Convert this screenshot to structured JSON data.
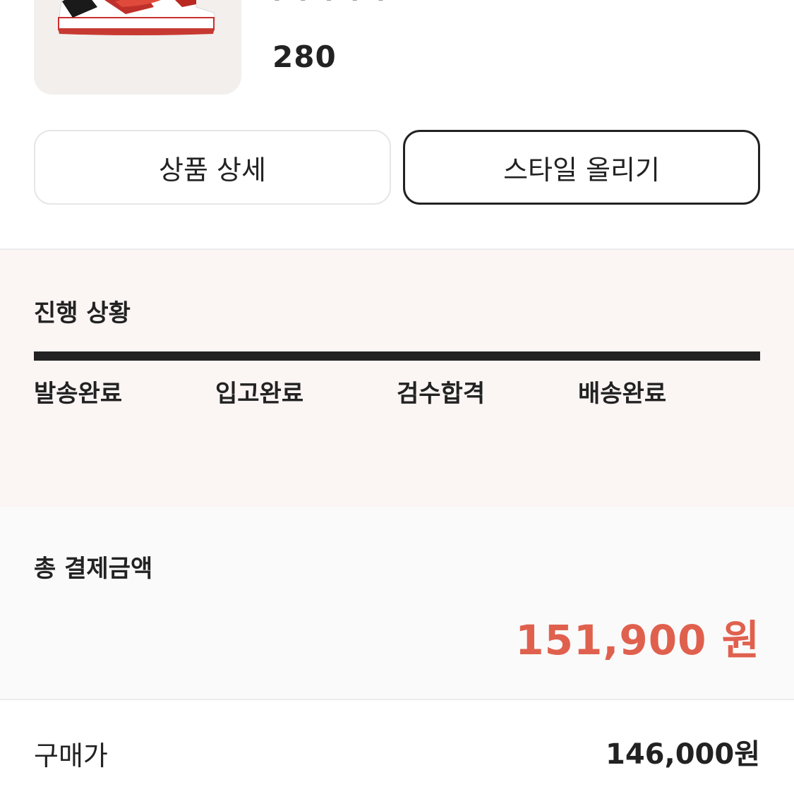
{
  "product": {
    "image_icon": "sneaker-image",
    "name_clipped": "· · · · ·",
    "size": "280"
  },
  "actions": {
    "detail_label": "상품 상세",
    "style_label": "스타일 올리기"
  },
  "progress": {
    "title": "진행 상황",
    "steps": [
      "발송완료",
      "입고완료",
      "검수합격",
      "배송완료"
    ],
    "completed_fraction": 1.0
  },
  "payment": {
    "title": "총 결제금액",
    "total": "151,900 원",
    "purchase_label": "구매가",
    "purchase_value": "146,000원"
  },
  "colors": {
    "accent": "#e0604e",
    "progress_bg": "#fbf5f4",
    "thumb_bg": "#f2efed"
  }
}
